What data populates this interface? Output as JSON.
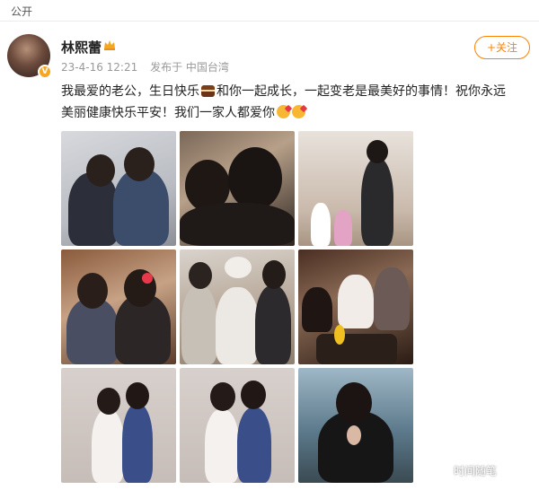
{
  "visibility_label": "公开",
  "post": {
    "author": "林熙蕾",
    "author_badge": "V",
    "timestamp": "23-4-16 12:21",
    "source": "发布于 中国台湾",
    "follow_label": "+关注",
    "text_line1_a": "我最爱的老公，生日快乐",
    "text_line1_b": "和你一起成长，一起变老是最美好的事情！祝你永远",
    "text_line2": "美丽健康快乐平安！我们一家人都爱你",
    "emoji": [
      "cake-icon",
      "kiss-icon",
      "kiss-icon"
    ],
    "photos": [
      "photo-1",
      "photo-2",
      "photo-3",
      "photo-4",
      "photo-5",
      "photo-6",
      "photo-7",
      "photo-8",
      "photo-9"
    ]
  },
  "watermark": "时间随笔",
  "colors": {
    "accent": "#ff8200",
    "badge": "#f5a623",
    "meta": "#999999"
  }
}
